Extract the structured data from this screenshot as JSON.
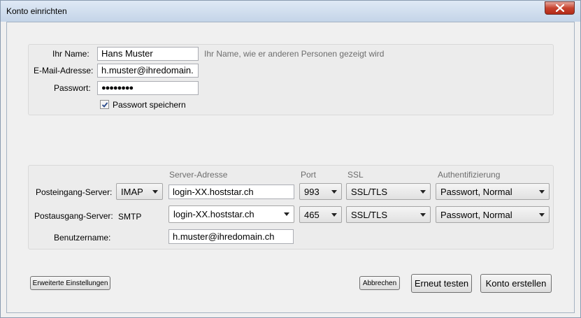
{
  "window": {
    "title": "Konto einrichten"
  },
  "identity": {
    "name_label": "Ihr Name:",
    "name_value": "Hans Muster",
    "name_hint": "Ihr Name, wie er anderen Personen gezeigt wird",
    "email_label": "E-Mail-Adresse:",
    "email_value": "h.muster@ihredomain.",
    "password_label": "Passwort:",
    "password_value": "●●●●●●●●",
    "save_password_label": "Passwort speichern",
    "save_password_checked": true
  },
  "server": {
    "headers": {
      "address": "Server-Adresse",
      "port": "Port",
      "ssl": "SSL",
      "auth": "Authentifizierung"
    },
    "incoming": {
      "label": "Posteingang-Server:",
      "protocol": "IMAP",
      "address": "login-XX.hoststar.ch",
      "port": "993",
      "ssl": "SSL/TLS",
      "auth": "Passwort, Normal"
    },
    "outgoing": {
      "label": "Postausgang-Server:",
      "protocol": "SMTP",
      "address": "login-XX.hoststar.ch",
      "port": "465",
      "ssl": "SSL/TLS",
      "auth": "Passwort, Normal"
    },
    "username_label": "Benutzername:",
    "username_value": "h.muster@ihredomain.ch"
  },
  "buttons": {
    "advanced": "Erweiterte Einstellungen",
    "cancel": "Abbrechen",
    "retest": "Erneut testen",
    "create": "Konto erstellen"
  }
}
